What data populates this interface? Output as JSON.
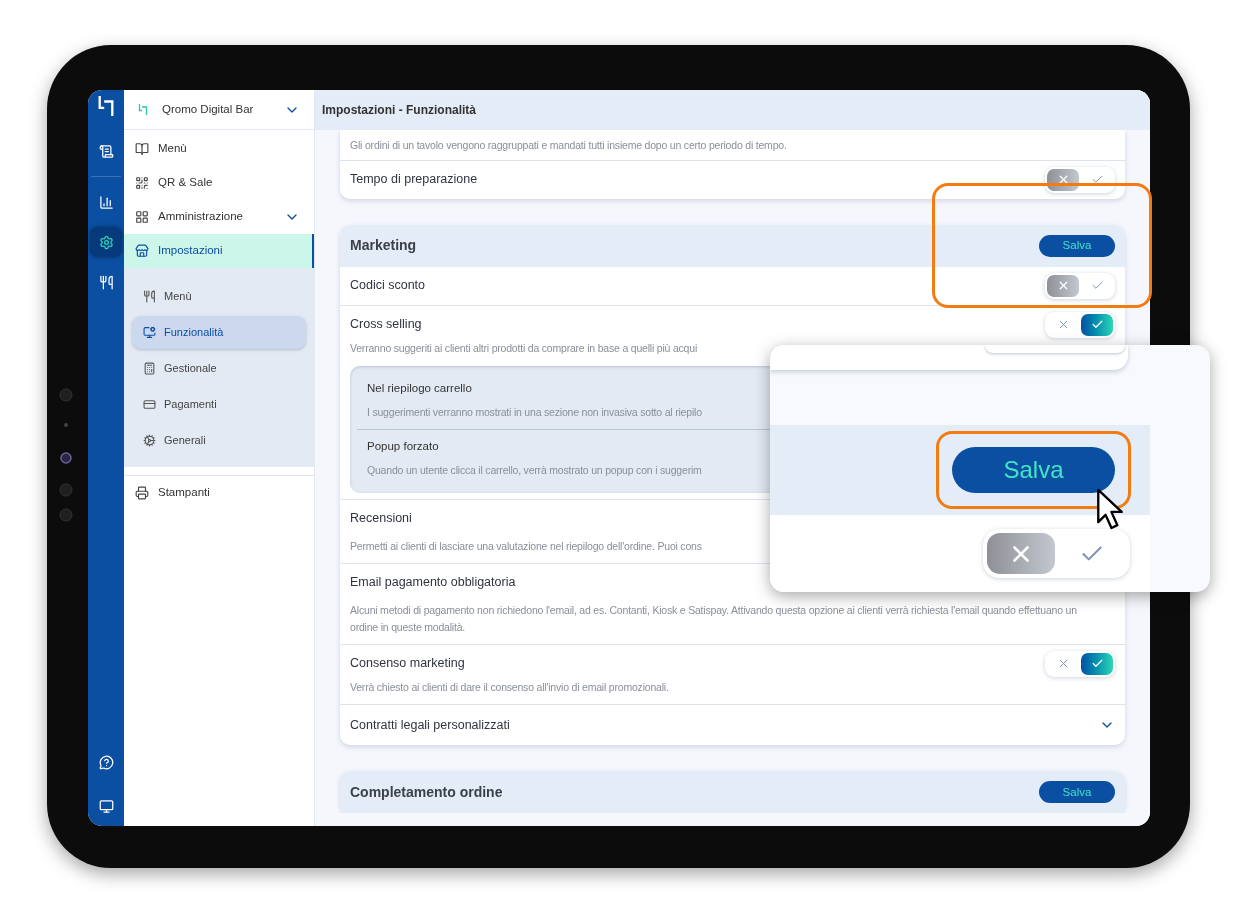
{
  "rail": {
    "items": [
      {
        "selected": false
      },
      {
        "selected": false
      },
      {
        "selected": true
      },
      {
        "selected": false
      }
    ]
  },
  "sidebar": {
    "venue": "Qromo Digital Bar",
    "items": [
      {
        "label": "Menù",
        "selected": false
      },
      {
        "label": "QR & Sale",
        "selected": false
      },
      {
        "label": "Amministrazione",
        "selected": false,
        "expanded": false
      },
      {
        "label": "Impostazioni",
        "selected": true,
        "children": [
          {
            "label": "Menù",
            "selected": false
          },
          {
            "label": "Funzionalità",
            "selected": true
          },
          {
            "label": "Gestionale",
            "selected": false
          },
          {
            "label": "Pagamenti",
            "selected": false
          },
          {
            "label": "Generali",
            "selected": false
          }
        ]
      },
      {
        "label": "Stampanti",
        "selected": false
      }
    ]
  },
  "header": {
    "title": "Impostazioni - Funzionalità"
  },
  "sections": [
    {
      "rows": [
        {
          "kind": "note",
          "text": "Gli ordini di un tavolo vengono raggruppati e mandati tutti insieme dopo un certo periodo di tempo."
        },
        {
          "kind": "toggle",
          "label": "Tempo di preparazione",
          "on": false
        }
      ]
    },
    {
      "title": "Marketing",
      "save": "Salva",
      "rows": [
        {
          "kind": "toggle",
          "label": "Codici sconto",
          "on": false
        },
        {
          "kind": "toggle",
          "label": "Cross selling",
          "on": true,
          "description": "Verranno suggeriti ai clienti altri prodotti da comprare in base a quelli più acqui",
          "options": [
            {
              "title": "Nel riepilogo carrello",
              "text": "I suggerimenti verranno mostrati in una sezione non invasiva sotto al riepilo"
            },
            {
              "title": "Popup forzato",
              "text": "Quando un utente clicca il carrello, verrà mostrato un popup con i suggerim"
            }
          ]
        },
        {
          "kind": "info",
          "label": "Recensioni",
          "description": "Permetti ai clienti di lasciare una valutazione nel riepilogo dell'ordine. Puoi cons"
        },
        {
          "kind": "info",
          "label": "Email pagamento obbligatoria",
          "description": "Alcuni metodi di pagamento non richiedono l'email, ad es. Contanti, Kiosk e Satispay. Attivando questa opzione ai clienti verrà richiesta l'email quando effettuano un ordine in queste modalità."
        },
        {
          "kind": "toggle",
          "label": "Consenso marketing",
          "on": true,
          "description": "Verrà chiesto ai clienti di dare il consenso all'invio di email promozionali."
        },
        {
          "kind": "expander",
          "label": "Contratti legali personalizzati",
          "expanded": false
        }
      ]
    },
    {
      "title": "Completamento ordine",
      "save": "Salva"
    }
  ],
  "callout": {
    "button": "Salva",
    "toggle_on": false
  }
}
